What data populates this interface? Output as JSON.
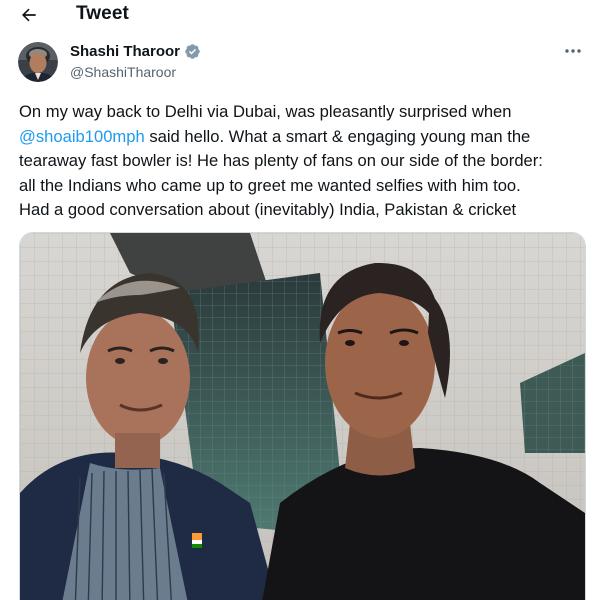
{
  "header": {
    "title": "Tweet",
    "back_icon": "arrow-left-icon"
  },
  "author": {
    "name": "Shashi Tharoor",
    "handle": "@ShashiTharoor",
    "verified": true,
    "verified_color": "#1d9bf0",
    "avatar_icon": "avatar"
  },
  "more_icon": "more-horizontal-icon",
  "tweet": {
    "line1": "On my way back to Delhi via Dubai, was pleasantly surprised when",
    "mention": "@shoaib100mph",
    "line2_rest": " said hello. What a smart & engaging young man the",
    "line3": "tearaway fast bowler is! He has plenty of fans on our side of the border:",
    "line4": "all the Indians who came up to greet me wanted selfies with him too.",
    "line5": "Had a good conversation about (inevitably) India, Pakistan & cricket"
  },
  "colors": {
    "text": "#0f1419",
    "secondary": "#536471",
    "link": "#1d9bf0"
  }
}
